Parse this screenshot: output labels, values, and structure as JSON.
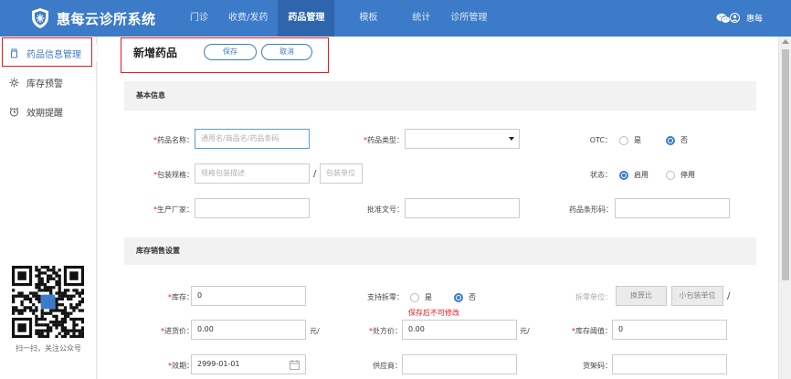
{
  "topbar": {
    "brand": "惠每云诊所系统",
    "nav": [
      "门诊",
      "收费/发药",
      "药品管理",
      "模板",
      "统计",
      "诊所管理"
    ],
    "active_nav": "药品管理",
    "user": "惠每"
  },
  "sidebar": {
    "items": [
      {
        "label": "药品信息管理",
        "icon": "medicine-bottle-icon"
      },
      {
        "label": "库存预警",
        "icon": "gear-icon"
      },
      {
        "label": "效期提醒",
        "icon": "alarm-clock-icon"
      }
    ],
    "qr_caption": "扫一扫，关注公众号"
  },
  "header": {
    "title": "新增药品",
    "save_label": "保存",
    "cancel_label": "取消"
  },
  "basic": {
    "section_title": "基本信息",
    "name_label": "药品名称：",
    "name_placeholder": "通用名/商品名/药品条码",
    "type_label": "药品类型：",
    "type_value": "",
    "otc_label": "OTC：",
    "otc_yes": "是",
    "otc_no": "否",
    "pack_label": "包装规格：",
    "pack_placeholder": "规格包装描述",
    "pack_sep": "/",
    "pack_unit_placeholder": "包装单位",
    "status_label": "状态：",
    "status_on": "启用",
    "status_off": "停用",
    "maker_label": "生产厂家：",
    "approval_label": "批准文号：",
    "barcode_label": "药品条形码："
  },
  "stock": {
    "section_title": "库存销售设置",
    "stock_label": "库存：",
    "stock_value": "0",
    "split_label": "支持拆零：",
    "split_yes": "是",
    "split_no": "否",
    "split_warn": "保存后不可修改",
    "split_unit_label": "拆零单位：",
    "ratio_placeholder": "换算比",
    "small_unit_placeholder": "小包装单位",
    "split_sep": "/",
    "buy_label": "进货价：",
    "buy_value": "0.00",
    "buy_unit": "元/",
    "rx_label": "处方价：",
    "rx_value": "0.00",
    "rx_unit": "元/",
    "threshold_label": "库存阈值：",
    "threshold_value": "0",
    "expiry_label": "效期：",
    "expiry_value": "2999-01-01",
    "supplier_label": "供应商：",
    "shelf_label": "货架码："
  },
  "colors": {
    "primary": "#3c7bc8",
    "highlight": "#e8161b"
  }
}
